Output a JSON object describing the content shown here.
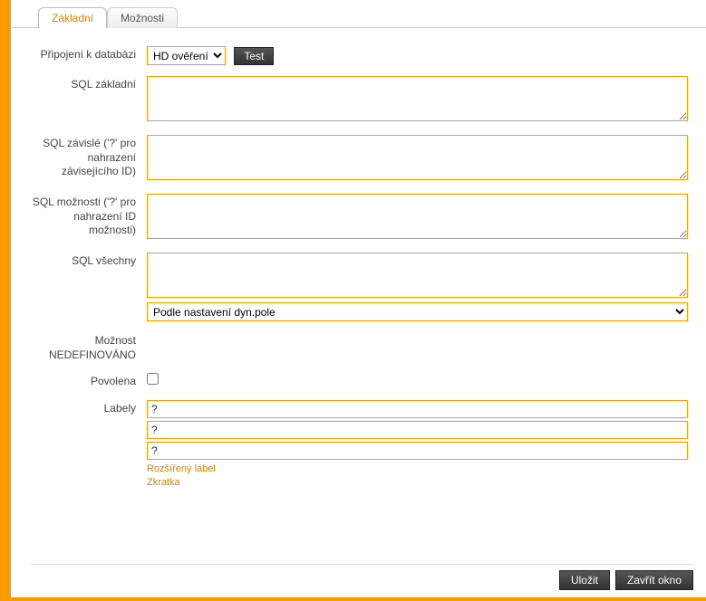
{
  "tabs": {
    "basic": "Základní",
    "options": "Možnosti"
  },
  "labels": {
    "dbconn": "Připojení k databázi",
    "sql_basic": "SQL základní",
    "sql_dep": "SQL závislé ('?' pro nahrazení závisejícího ID)",
    "sql_opt": "SQL možnosti ('?' pro nahrazení ID možnosti)",
    "sql_all": "SQL všechny",
    "opt_undef": "Možnost NEDEFINOVÁNO",
    "enabled": "Povolena",
    "labels_field": "Labely"
  },
  "fields": {
    "db_select": "HD ověření",
    "test_btn": "Test",
    "dyn_select": "Podle nastavení dyn.pole",
    "label1": "?",
    "label2": "?",
    "label3": "?"
  },
  "links": {
    "ext_label": "Rozšířený label",
    "shortcut": "Zkratka"
  },
  "footer": {
    "save": "Uložit",
    "close": "Zavřít okno"
  }
}
